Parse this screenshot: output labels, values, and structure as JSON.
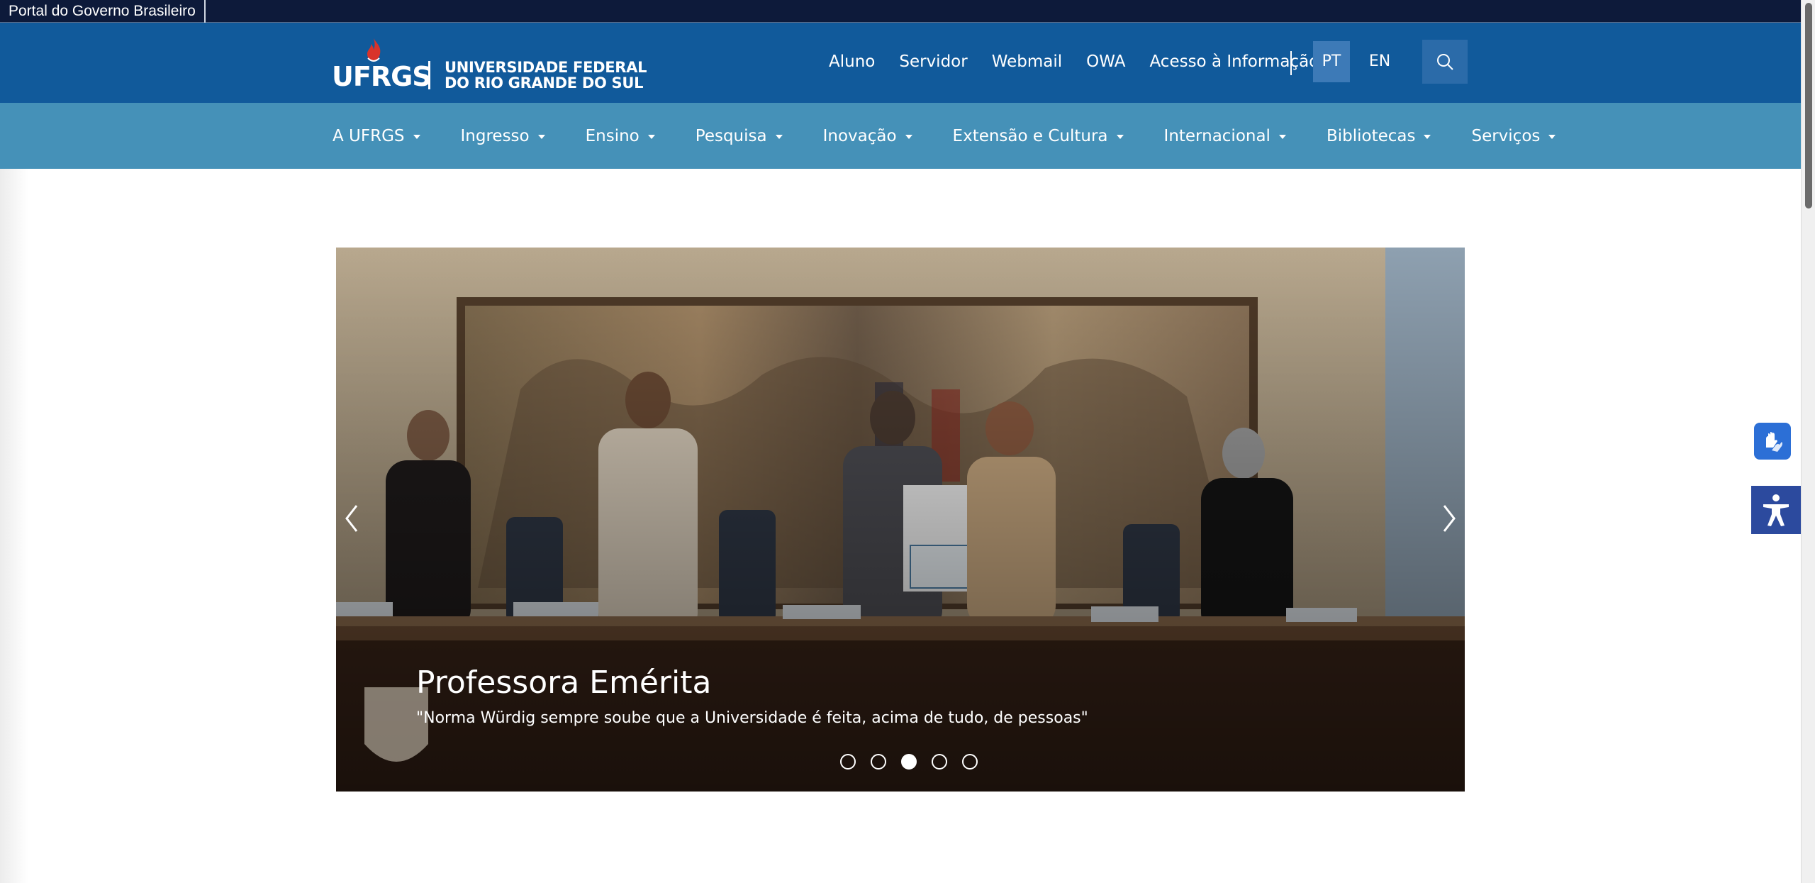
{
  "gov_bar": {
    "label": "Portal do Governo Brasileiro"
  },
  "header": {
    "logo": {
      "short": "UFRGS",
      "line1": "UNIVERSIDADE FEDERAL",
      "line2": "DO RIO GRANDE DO SUL"
    },
    "top_links": [
      "Aluno",
      "Servidor",
      "Webmail",
      "OWA",
      "Acesso à Informação"
    ],
    "languages": {
      "pt": "PT",
      "en": "EN",
      "selected": "PT"
    },
    "search_icon": "search-icon"
  },
  "nav": {
    "items": [
      "A UFRGS",
      "Ingresso",
      "Ensino",
      "Pesquisa",
      "Inovação",
      "Extensão e Cultura",
      "Internacional",
      "Bibliotecas",
      "Serviços"
    ]
  },
  "carousel": {
    "title": "Professora Emérita",
    "subtitle": "\"Norma Würdig sempre soube que a Universidade é feita, acima de tudo, de pessoas\"",
    "slide_count": 5,
    "active_index": 2,
    "prev_icon": "chevron-left-icon",
    "next_icon": "chevron-right-icon"
  },
  "widgets": {
    "vlibras_icon": "sign-language-icon",
    "accessibility_icon": "accessibility-icon"
  },
  "colors": {
    "gov_bar": "#0d1a3a",
    "header": "#115a9b",
    "nav": "#4591b8",
    "accent_red": "#d9332b"
  }
}
